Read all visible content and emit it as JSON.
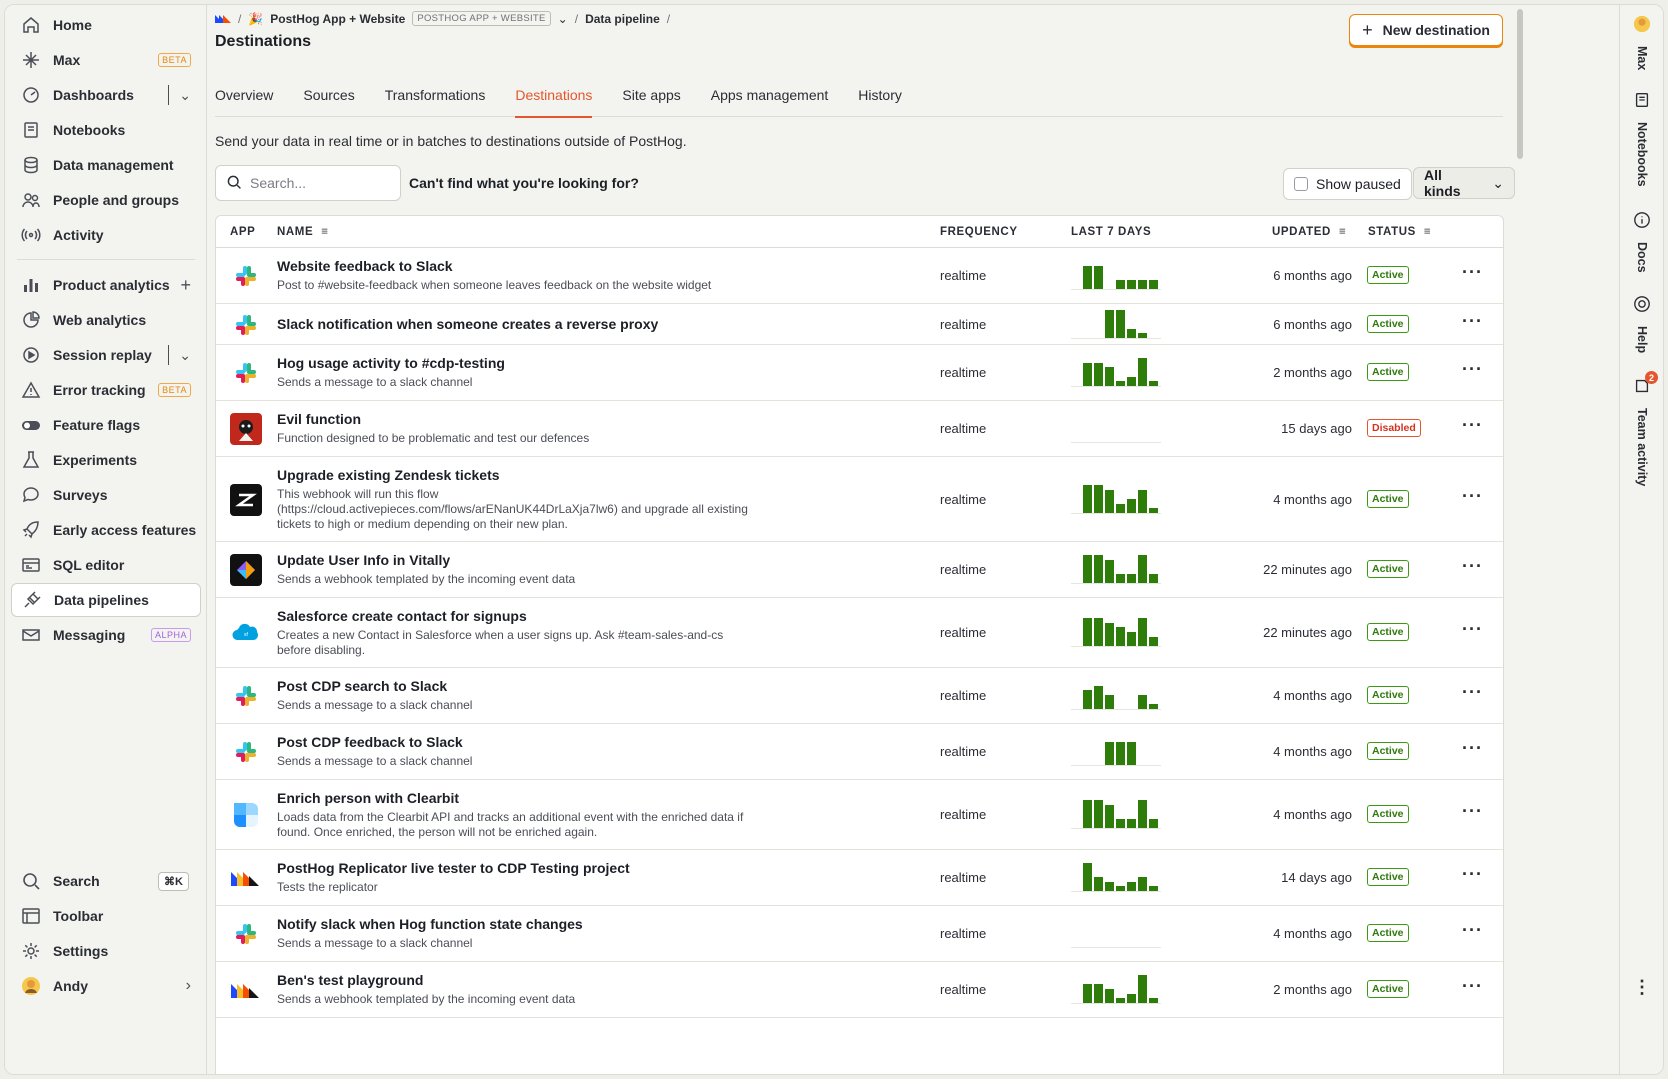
{
  "sidebar": {
    "items": [
      {
        "label": "Home",
        "icon": "home-icon"
      },
      {
        "label": "Max",
        "icon": "sparkle-icon",
        "badge": "BETA"
      },
      {
        "label": "Dashboards",
        "icon": "dashboard-icon"
      },
      {
        "label": "Notebooks",
        "icon": "notebook-icon"
      },
      {
        "label": "Data management",
        "icon": "database-icon"
      },
      {
        "label": "People and groups",
        "icon": "people-icon"
      },
      {
        "label": "Activity",
        "icon": "activity-icon"
      },
      {
        "label": "Product analytics",
        "icon": "bar-chart-icon"
      },
      {
        "label": "Web analytics",
        "icon": "pie-icon"
      },
      {
        "label": "Session replay",
        "icon": "play-icon"
      },
      {
        "label": "Error tracking",
        "icon": "warning-icon",
        "badge": "BETA"
      },
      {
        "label": "Feature flags",
        "icon": "toggle-icon"
      },
      {
        "label": "Experiments",
        "icon": "flask-icon"
      },
      {
        "label": "Surveys",
        "icon": "chat-icon"
      },
      {
        "label": "Early access features",
        "icon": "rocket-icon"
      },
      {
        "label": "SQL editor",
        "icon": "sql-icon"
      },
      {
        "label": "Data pipelines",
        "icon": "plug-icon"
      },
      {
        "label": "Messaging",
        "icon": "message-icon",
        "badge": "ALPHA"
      }
    ],
    "bottom": [
      {
        "label": "Search",
        "icon": "search-icon",
        "shortcut": "⌘K"
      },
      {
        "label": "Toolbar",
        "icon": "toolbar-icon"
      },
      {
        "label": "Settings",
        "icon": "gear-icon"
      },
      {
        "label": "Andy",
        "icon": "avatar"
      }
    ]
  },
  "header": {
    "breadcrumb": {
      "project": "PostHog App + Website",
      "project_tag": "POSTHOG APP + WEBSITE",
      "section": "Data pipeline"
    },
    "title": "Destinations",
    "new_button": "New destination"
  },
  "tabs": [
    "Overview",
    "Sources",
    "Transformations",
    "Destinations",
    "Site apps",
    "Apps management",
    "History"
  ],
  "active_tab": "Destinations",
  "description": "Send your data in real time or in batches to destinations outside of PostHog.",
  "search": {
    "placeholder": "Search..."
  },
  "cant_find": "Can't find what you're looking for?",
  "show_paused": "Show paused",
  "kinds_select": "All kinds",
  "table": {
    "headers": {
      "app": "APP",
      "name": "NAME",
      "frequency": "FREQUENCY",
      "last7": "LAST 7 DAYS",
      "updated": "UPDATED",
      "status": "STATUS"
    },
    "rows": [
      {
        "app": "slack",
        "name": "Website feedback to Slack",
        "desc": "Post to #website-feedback when someone leaves feedback on the website widget",
        "freq": "realtime",
        "spark": [
          5,
          5,
          0,
          2,
          2,
          2,
          2
        ],
        "updated": "6 months ago",
        "status": "Active"
      },
      {
        "app": "slack",
        "name": "Slack notification when someone creates a reverse proxy",
        "desc": "",
        "freq": "realtime",
        "spark": [
          0,
          0,
          6,
          6,
          2,
          1,
          0
        ],
        "updated": "6 months ago",
        "status": "Active"
      },
      {
        "app": "slack",
        "name": "Hog usage activity to #cdp-testing",
        "desc": "Sends a message to a slack channel",
        "freq": "realtime",
        "spark": [
          5,
          5,
          4,
          1,
          2,
          6,
          1
        ],
        "updated": "2 months ago",
        "status": "Active"
      },
      {
        "app": "evil",
        "name": "Evil function",
        "desc": "Function designed to be problematic and test our defences",
        "freq": "realtime",
        "spark": [],
        "updated": "15 days ago",
        "status": "Disabled"
      },
      {
        "app": "zendesk",
        "name": "Upgrade existing Zendesk tickets",
        "desc": "This webhook will run this flow (https://cloud.activepieces.com/flows/arENanUK44DrLaXja7lw6) and upgrade all existing tickets to high or medium depending on their new plan.",
        "freq": "realtime",
        "spark": [
          6,
          6,
          5,
          2,
          3,
          5,
          1
        ],
        "updated": "4 months ago",
        "status": "Active"
      },
      {
        "app": "vitally",
        "name": "Update User Info in Vitally",
        "desc": "Sends a webhook templated by the incoming event data",
        "freq": "realtime",
        "spark": [
          6,
          6,
          5,
          2,
          2,
          6,
          2
        ],
        "updated": "22 minutes ago",
        "status": "Active"
      },
      {
        "app": "salesforce",
        "name": "Salesforce create contact for signups",
        "desc": "Creates a new Contact in Salesforce when a user signs up. Ask #team-sales-and-cs before disabling.",
        "freq": "realtime",
        "spark": [
          6,
          6,
          5,
          4,
          3,
          6,
          2
        ],
        "updated": "22 minutes ago",
        "status": "Active"
      },
      {
        "app": "slack",
        "name": "Post CDP search to Slack",
        "desc": "Sends a message to a slack channel",
        "freq": "realtime",
        "spark": [
          4,
          5,
          3,
          0,
          0,
          3,
          1
        ],
        "updated": "4 months ago",
        "status": "Active"
      },
      {
        "app": "slack",
        "name": "Post CDP feedback to Slack",
        "desc": "Sends a message to a slack channel",
        "freq": "realtime",
        "spark": [
          0,
          0,
          5,
          5,
          5,
          0,
          0
        ],
        "updated": "4 months ago",
        "status": "Active"
      },
      {
        "app": "clearbit",
        "name": "Enrich person with Clearbit",
        "desc": "Loads data from the Clearbit API and tracks an additional event with the enriched data if found. Once enriched, the person will not be enriched again.",
        "freq": "realtime",
        "spark": [
          6,
          6,
          5,
          2,
          2,
          6,
          2
        ],
        "updated": "4 months ago",
        "status": "Active"
      },
      {
        "app": "posthog",
        "name": "PostHog Replicator live tester to CDP Testing project",
        "desc": "Tests the replicator",
        "freq": "realtime",
        "spark": [
          6,
          3,
          2,
          1,
          2,
          3,
          1
        ],
        "updated": "14 days ago",
        "status": "Active"
      },
      {
        "app": "slack",
        "name": "Notify slack when Hog function state changes",
        "desc": "Sends a message to a slack channel",
        "freq": "realtime",
        "spark": [],
        "updated": "4 months ago",
        "status": "Active"
      },
      {
        "app": "posthog",
        "name": "Ben's test playground",
        "desc": "Sends a webhook templated by the incoming event data",
        "freq": "realtime",
        "spark": [
          4,
          4,
          3,
          1,
          2,
          6,
          1
        ],
        "updated": "2 months ago",
        "status": "Active"
      }
    ]
  },
  "rail": [
    {
      "label": "Max",
      "icon": "avatar"
    },
    {
      "label": "Notebooks",
      "icon": "notebook-icon"
    },
    {
      "label": "Docs",
      "icon": "info-icon"
    },
    {
      "label": "Help",
      "icon": "lifebuoy-icon"
    },
    {
      "label": "Team activity",
      "icon": "activity-icon",
      "count": "2"
    }
  ],
  "colors": {
    "accent": "#e4572e",
    "brand_button": "#e9860b",
    "active": "#2f7a0b",
    "spark": "#2e7d0b"
  }
}
